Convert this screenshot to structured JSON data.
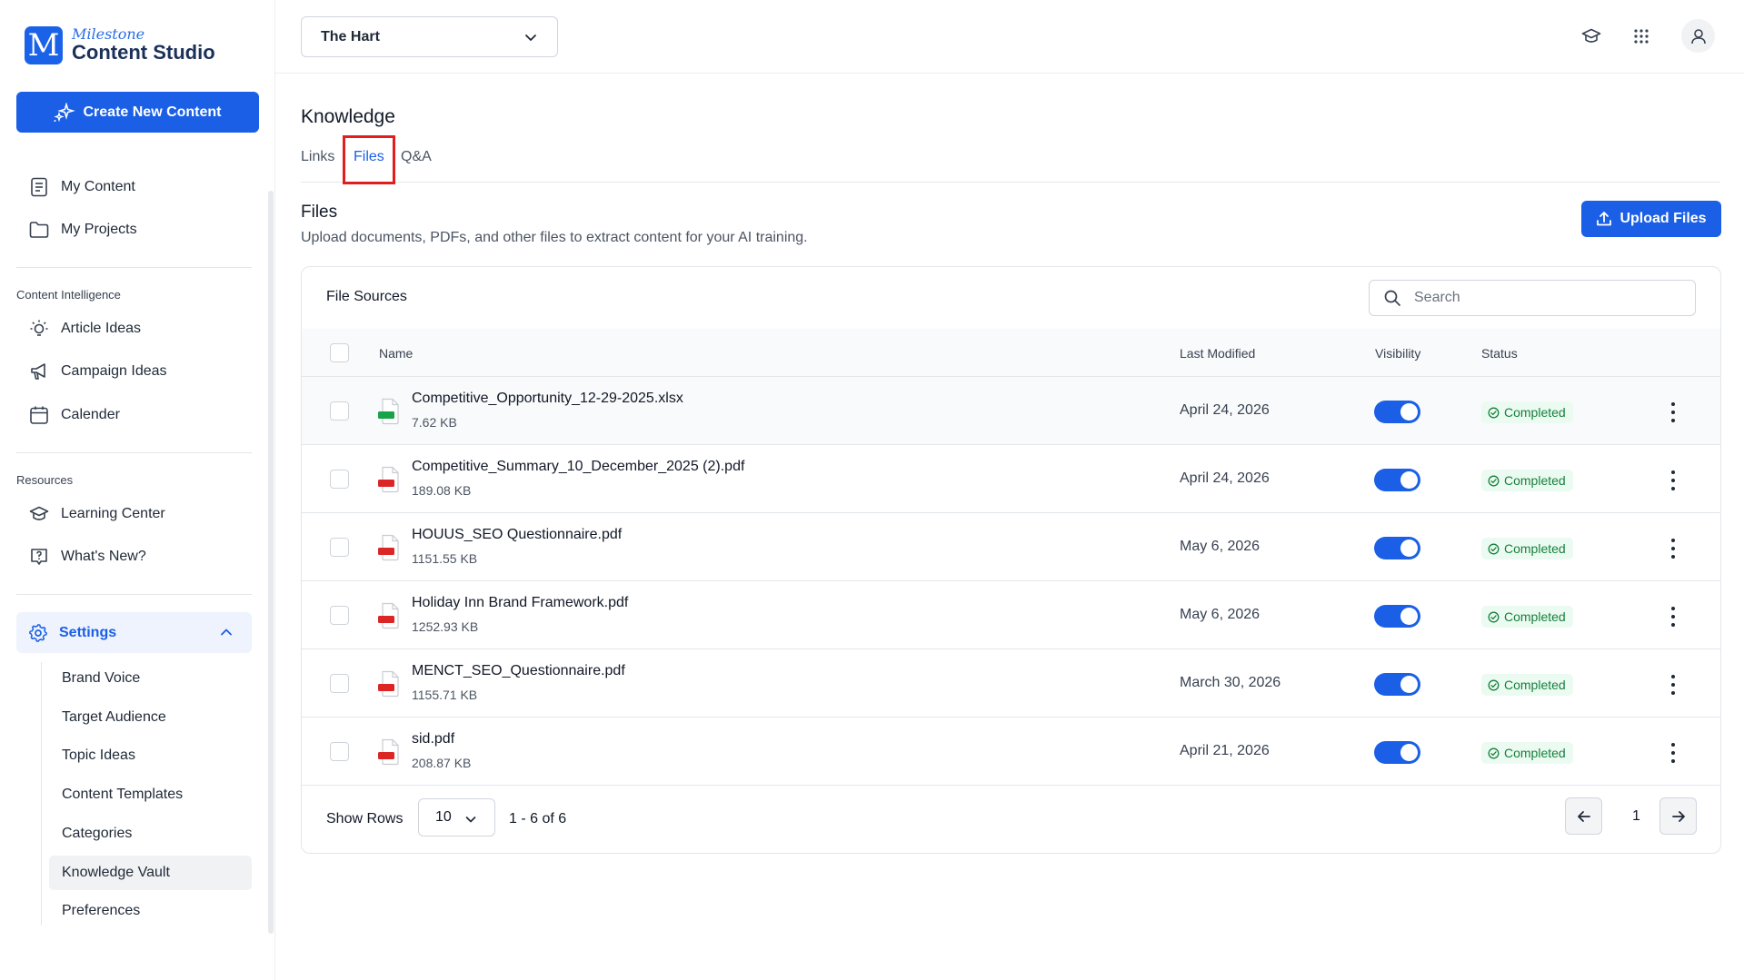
{
  "logo": {
    "top": "Milestone",
    "bottom": "Content Studio",
    "mark": "M"
  },
  "sidebar": {
    "create_label": "Create New Content",
    "items": [
      {
        "label": "My Content",
        "icon": "document-icon"
      },
      {
        "label": "My Projects",
        "icon": "folder-icon"
      }
    ],
    "intelligence_label": "Content Intelligence",
    "intelligence_items": [
      {
        "label": "Article Ideas",
        "icon": "lightbulb-icon"
      },
      {
        "label": "Campaign Ideas",
        "icon": "megaphone-icon"
      },
      {
        "label": "Calender",
        "icon": "calendar-icon"
      }
    ],
    "resources_label": "Resources",
    "resources_items": [
      {
        "label": "Learning Center",
        "icon": "graduation-cap-icon"
      },
      {
        "label": "What's New?",
        "icon": "question-icon"
      }
    ],
    "settings_label": "Settings",
    "settings_items": [
      {
        "label": "Brand Voice"
      },
      {
        "label": "Target Audience"
      },
      {
        "label": "Topic Ideas"
      },
      {
        "label": "Content Templates"
      },
      {
        "label": "Categories"
      },
      {
        "label": "Knowledge Vault",
        "active": true
      },
      {
        "label": "Preferences"
      }
    ]
  },
  "header": {
    "site": "The Hart"
  },
  "main": {
    "title": "Knowledge",
    "tabs": [
      {
        "label": "Links"
      },
      {
        "label": "Files",
        "active": true
      },
      {
        "label": "Q&A"
      }
    ],
    "section_title": "Files",
    "section_desc": "Upload documents, PDFs, and other files to extract content for your AI training.",
    "upload_label": "Upload Files"
  },
  "table": {
    "title": "File Sources",
    "search_placeholder": "Search",
    "columns": {
      "name": "Name",
      "modified": "Last Modified",
      "visibility": "Visibility",
      "status": "Status"
    },
    "rows": [
      {
        "name": "Competitive_Opportunity_12-29-2025.xlsx",
        "size": "7.62 KB",
        "modified": "April 24, 2026",
        "visible": true,
        "status": "Completed",
        "type": "XLSX"
      },
      {
        "name": "Competitive_Summary_10_December_2025 (2).pdf",
        "size": "189.08 KB",
        "modified": "April 24, 2026",
        "visible": true,
        "status": "Completed",
        "type": "PDF"
      },
      {
        "name": "HOUUS_SEO Questionnaire.pdf",
        "size": "1151.55 KB",
        "modified": "May 6, 2026",
        "visible": true,
        "status": "Completed",
        "type": "PDF"
      },
      {
        "name": "Holiday Inn Brand Framework.pdf",
        "size": "1252.93 KB",
        "modified": "May 6, 2026",
        "visible": true,
        "status": "Completed",
        "type": "PDF"
      },
      {
        "name": "MENCT_SEO_Questionnaire.pdf",
        "size": "1155.71 KB",
        "modified": "March 30, 2026",
        "visible": true,
        "status": "Completed",
        "type": "PDF"
      },
      {
        "name": "sid.pdf",
        "size": "208.87 KB",
        "modified": "April 21, 2026",
        "visible": true,
        "status": "Completed",
        "type": "PDF"
      }
    ],
    "footer": {
      "show_rows_label": "Show Rows",
      "rows_value": "10",
      "range": "1 - 6 of 6",
      "page": "1"
    }
  },
  "colors": {
    "accent": "#1a5fe6",
    "success": "#15803d",
    "success_bg": "#ecfbf1",
    "highlight": "#e11d1d",
    "xlsx": "#16a34a",
    "pdf": "#dc2626"
  }
}
